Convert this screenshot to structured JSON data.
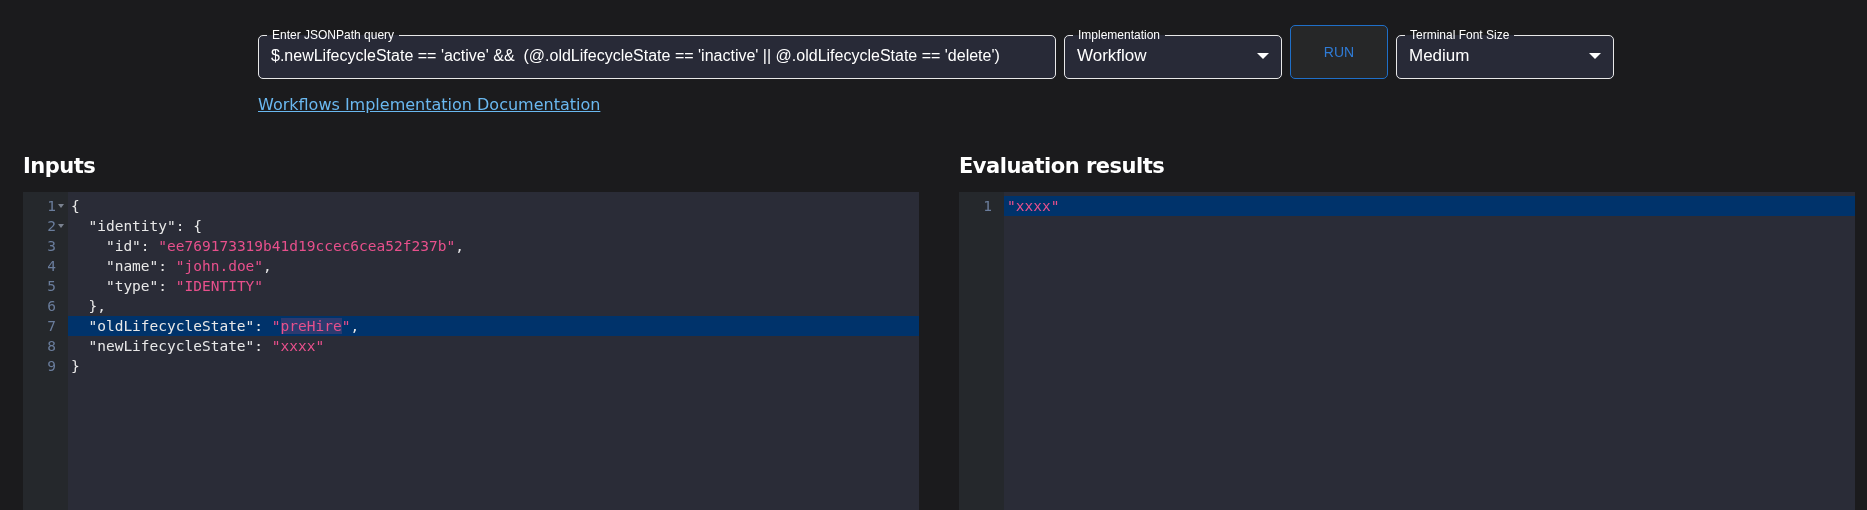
{
  "query": {
    "label": "Enter JSONPath query",
    "value": "$.newLifecycleState == 'active' &&  (@.oldLifecycleState == 'inactive' || @.oldLifecycleState == 'delete')"
  },
  "implementation": {
    "label": "Implementation",
    "value": "Workflow"
  },
  "run_button": {
    "label": "RUN"
  },
  "font_size": {
    "label": "Terminal Font Size",
    "value": "Medium"
  },
  "doc_link": {
    "label": "Workflows Implementation Documentation"
  },
  "inputs": {
    "title": "Inputs",
    "lines": [
      {
        "number": "1",
        "fold": true,
        "active": false,
        "tokens": [
          {
            "kind": "punct",
            "text": "{"
          }
        ]
      },
      {
        "number": "2",
        "fold": true,
        "active": false,
        "tokens": [
          {
            "kind": "key",
            "text": "  \"identity\""
          },
          {
            "kind": "punct",
            "text": ": {"
          }
        ]
      },
      {
        "number": "3",
        "fold": false,
        "active": false,
        "tokens": [
          {
            "kind": "key",
            "text": "    \"id\""
          },
          {
            "kind": "punct",
            "text": ": "
          },
          {
            "kind": "string",
            "text": "\"ee769173319b41d19ccec6cea52f237b\""
          },
          {
            "kind": "punct",
            "text": ","
          }
        ]
      },
      {
        "number": "4",
        "fold": false,
        "active": false,
        "tokens": [
          {
            "kind": "key",
            "text": "    \"name\""
          },
          {
            "kind": "punct",
            "text": ": "
          },
          {
            "kind": "string",
            "text": "\"john.doe\""
          },
          {
            "kind": "punct",
            "text": ","
          }
        ]
      },
      {
        "number": "5",
        "fold": false,
        "active": false,
        "tokens": [
          {
            "kind": "key",
            "text": "    \"type\""
          },
          {
            "kind": "punct",
            "text": ": "
          },
          {
            "kind": "string",
            "text": "\"IDENTITY\""
          }
        ]
      },
      {
        "number": "6",
        "fold": false,
        "active": false,
        "tokens": [
          {
            "kind": "punct",
            "text": "  },"
          }
        ]
      },
      {
        "number": "7",
        "fold": false,
        "active": true,
        "tokens": [
          {
            "kind": "key",
            "text": "  \"oldLifecycleState\""
          },
          {
            "kind": "punct",
            "text": ": "
          },
          {
            "kind": "string",
            "text": "\""
          },
          {
            "kind": "selected",
            "text": "preHire"
          },
          {
            "kind": "string",
            "text": "\""
          },
          {
            "kind": "punct",
            "text": ","
          }
        ]
      },
      {
        "number": "8",
        "fold": false,
        "active": false,
        "tokens": [
          {
            "kind": "key",
            "text": "  \"newLifecycleState\""
          },
          {
            "kind": "punct",
            "text": ": "
          },
          {
            "kind": "string",
            "text": "\"xxxx\""
          }
        ]
      },
      {
        "number": "9",
        "fold": false,
        "active": false,
        "tokens": [
          {
            "kind": "punct",
            "text": "}"
          }
        ]
      }
    ]
  },
  "results": {
    "title": "Evaluation results",
    "lines": [
      {
        "number": "1",
        "fold": false,
        "active": true,
        "tokens": [
          {
            "kind": "string",
            "text": "\"xxxx\""
          }
        ]
      }
    ]
  }
}
